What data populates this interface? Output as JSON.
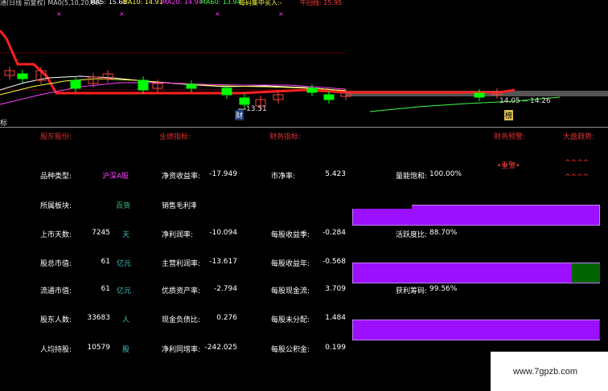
{
  "header": {
    "segments": [
      {
        "text": "通(日线 前复权) MA0(5,10,20,60)",
        "color": "#d0d0d0"
      },
      {
        "text": "MA5: 15.61",
        "color": "#ffffff"
      },
      {
        "text": "MA10: 14.91",
        "color": "#ffff40"
      },
      {
        "text": "MA20: 14.94",
        "color": "#ff40ff"
      },
      {
        "text": "MA60: 13.94",
        "color": "#40ff40"
      },
      {
        "text": "每码集中买入:-",
        "color": "#ffff40"
      },
      {
        "text": "牛回线: 15.95",
        "color": "#ff4040"
      }
    ]
  },
  "chart": {
    "low_label": "13.51",
    "right_label": "14.05 -- 14.26",
    "tag_left": "财",
    "tag_right": "榜",
    "x_marks": [
      "×",
      "×",
      "×",
      "×"
    ],
    "colors": {
      "up": "#ff4040",
      "down": "#00ff00",
      "ma5": "#ffffff",
      "ma10": "#ffff40",
      "ma20": "#ff40ff",
      "ma60": "#40ff40",
      "red_line": "#ff2020"
    }
  },
  "panel": {
    "tab_label": "标",
    "section_headers": [
      "股东股份:",
      "业绩指标:",
      "财务指标:",
      "财务预警:",
      "大盘趋势:"
    ],
    "warning_label": "•重警•",
    "trend_top": "^^^^",
    "trend_bottom": "^^^^",
    "col1": [
      {
        "label": "品种类型:",
        "value": "沪深A股",
        "unit": ""
      },
      {
        "label": "所属板块:",
        "value": "百货",
        "unit": ""
      },
      {
        "label": "上市天数:",
        "value": "7245",
        "unit": "天"
      },
      {
        "label": "股总市值:",
        "value": "61",
        "unit": "亿元"
      },
      {
        "label": "流通市值:",
        "value": "61",
        "unit": "亿元"
      },
      {
        "label": "股东人数:",
        "value": "33683",
        "unit": "人"
      },
      {
        "label": "人均持股:",
        "value": "10579",
        "unit": "股"
      }
    ],
    "col2": [
      {
        "label": "净资收益率:",
        "value": "-17.949"
      },
      {
        "label": "销售毛利率:",
        "value": ""
      },
      {
        "label": "净利润率:",
        "value": "-10.094"
      },
      {
        "label": "主营利润率:",
        "value": "-13.617"
      },
      {
        "label": "优质资产率:",
        "value": "-2.794"
      },
      {
        "label": "现金负债比:",
        "value": "0.276"
      },
      {
        "label": "净利同增率:",
        "value": "-242.025"
      }
    ],
    "col3": [
      {
        "label": "市净率:",
        "value": "5.423"
      },
      {
        "label": "",
        "value": ""
      },
      {
        "label": "每股收益季:",
        "value": "-0.284"
      },
      {
        "label": "每股收益年:",
        "value": "-0.568"
      },
      {
        "label": "每股现金流:",
        "value": "3.709"
      },
      {
        "label": "每股未分配:",
        "value": "1.484"
      },
      {
        "label": "每股公积金:",
        "value": "0.199"
      }
    ],
    "bars": [
      {
        "label": "量能饱和:",
        "value": "100.00%",
        "fraction": 1.0
      },
      {
        "label": "活跃度比:",
        "value": "88.70%",
        "fraction": 0.887
      },
      {
        "label": "获利筹码:",
        "value": "99.56%",
        "fraction": 0.9956
      }
    ]
  },
  "watermark": "www.7gpzb.com"
}
